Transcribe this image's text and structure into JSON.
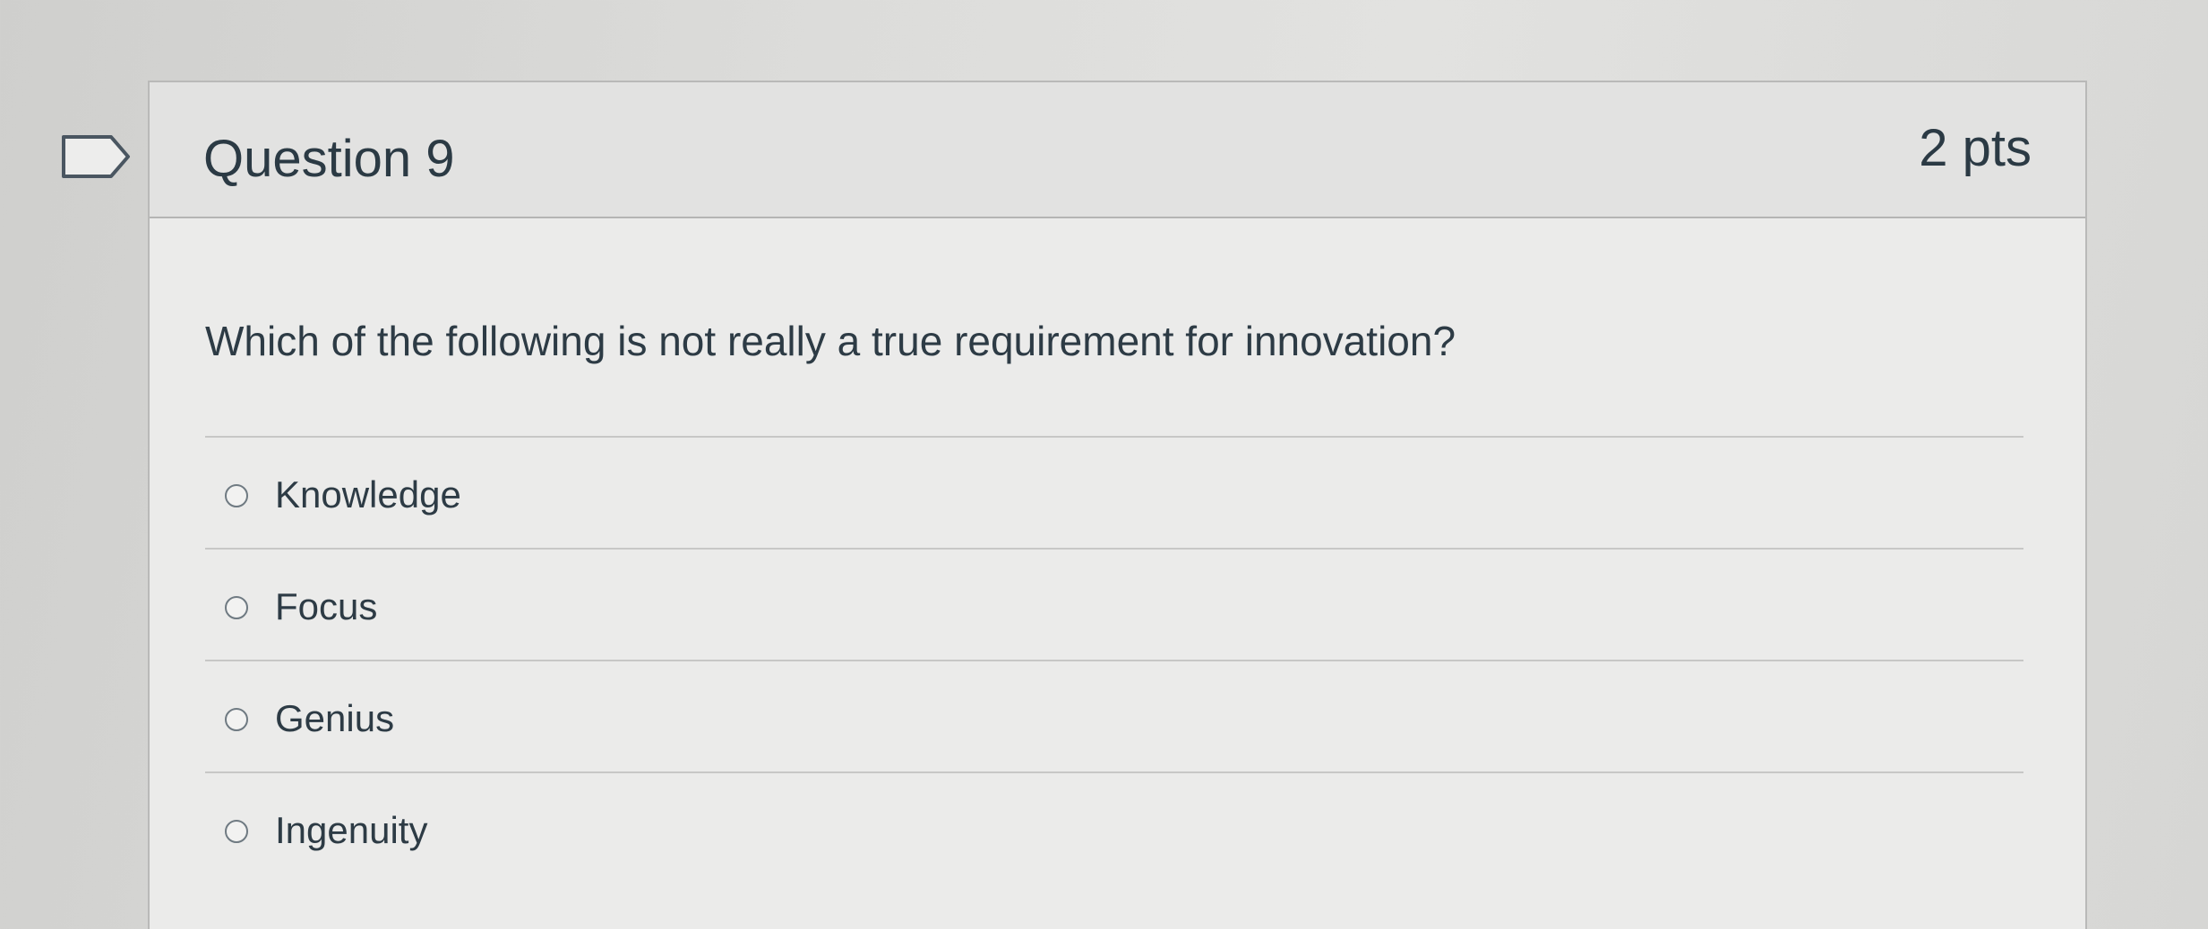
{
  "question": {
    "title": "Question 9",
    "points": "2 pts",
    "text": "Which of the following is not really a true requirement for innovation?",
    "answers": [
      {
        "label": "Knowledge",
        "selected": false
      },
      {
        "label": "Focus",
        "selected": false
      },
      {
        "label": "Genius",
        "selected": false
      },
      {
        "label": "Ingenuity",
        "selected": false
      }
    ]
  },
  "icons": {
    "flag": "flag-outline-icon",
    "radio": "radio-unchecked-icon"
  }
}
